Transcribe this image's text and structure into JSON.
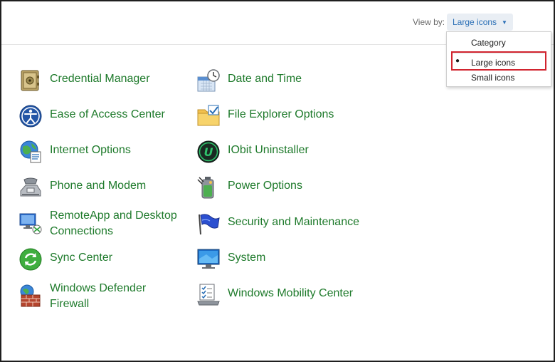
{
  "toolbar": {
    "view_by_label": "View by:",
    "view_by_value": "Large icons"
  },
  "dropdown": {
    "options": [
      "Category",
      "Large icons",
      "Small icons"
    ],
    "selected": "Large icons"
  },
  "items": [
    {
      "label": "Credential Manager",
      "icon": "vault-icon"
    },
    {
      "label": "Date and Time",
      "icon": "calendar-clock-icon"
    },
    {
      "label": "Ease of Access Center",
      "icon": "accessibility-icon"
    },
    {
      "label": "File Explorer Options",
      "icon": "folder-options-icon"
    },
    {
      "label": "Internet Options",
      "icon": "globe-icon"
    },
    {
      "label": "IObit Uninstaller",
      "icon": "iobit-u-icon"
    },
    {
      "label": "Phone and Modem",
      "icon": "phone-modem-icon"
    },
    {
      "label": "Power Options",
      "icon": "battery-power-icon"
    },
    {
      "label": "RemoteApp and Desktop Connections",
      "icon": "remote-desktop-icon"
    },
    {
      "label": "Security and Maintenance",
      "icon": "flag-icon"
    },
    {
      "label": "Sync Center",
      "icon": "sync-icon"
    },
    {
      "label": "System",
      "icon": "monitor-icon"
    },
    {
      "label": "Windows Defender Firewall",
      "icon": "firewall-icon"
    },
    {
      "label": "Windows Mobility Center",
      "icon": "mobility-checklist-icon"
    }
  ],
  "colors": {
    "link_green": "#1e7a2b",
    "accent_blue": "#2a6fb6",
    "highlight_red": "#d1242f"
  }
}
